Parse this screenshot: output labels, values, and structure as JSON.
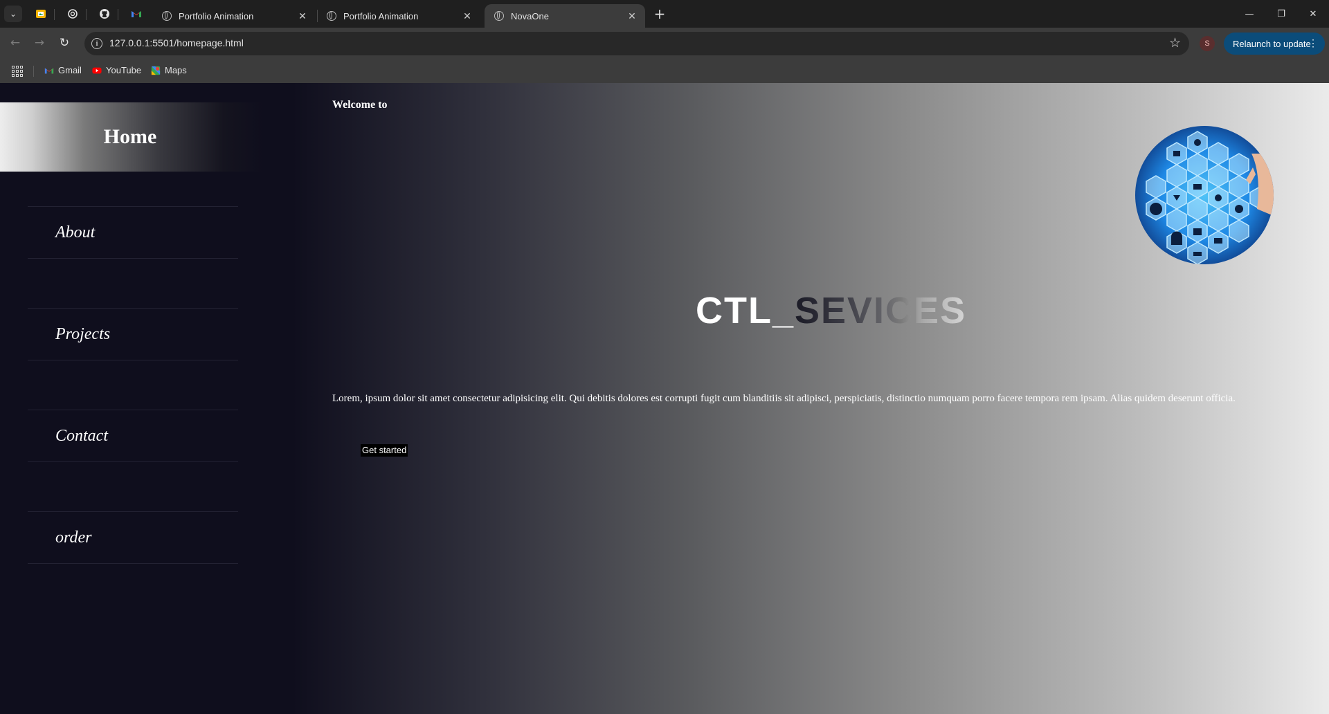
{
  "browser": {
    "tabs": [
      {
        "title": "Portfolio Animation",
        "active": false
      },
      {
        "title": "Portfolio Animation",
        "active": false
      },
      {
        "title": "NovaOne",
        "active": true
      }
    ],
    "address_url": "127.0.0.1:5501/homepage.html",
    "profile_initial": "S",
    "relaunch_label": "Relaunch to update",
    "bookmarks": [
      "Gmail",
      "YouTube",
      "Maps"
    ]
  },
  "sidebar": {
    "home_label": "Home",
    "items": [
      {
        "label": "About"
      },
      {
        "label": "Projects"
      },
      {
        "label": "Contact"
      },
      {
        "label": "order"
      }
    ]
  },
  "hero": {
    "welcome": "Welcome to",
    "title_part1": "CTL_",
    "title_part2": "SEVICES",
    "body": "Lorem, ipsum dolor sit amet consectetur adipisicing elit. Qui debitis dolores est corrupti fugit cum blanditiis sit adipisci, perspiciatis, distinctio numquam porro facere tempora rem ipsam. Alias quidem deserunt officia.",
    "cta_label": "Get started"
  },
  "colors": {
    "sidebar_bg": "#0f0e1d",
    "relaunch_bg": "#0b4c7a",
    "hero_image_blue": "#1e88e5"
  }
}
